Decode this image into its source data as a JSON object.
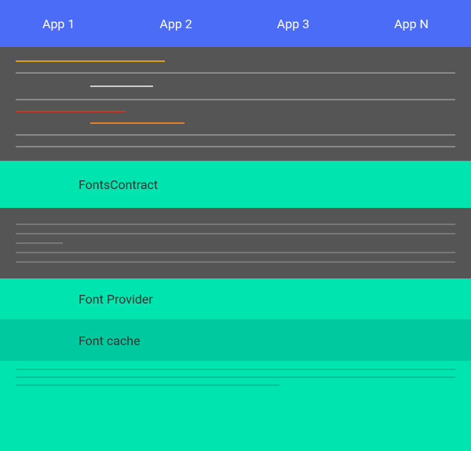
{
  "topBar": {
    "tabs": [
      {
        "id": "app1",
        "label": "App 1"
      },
      {
        "id": "app2",
        "label": "App 2"
      },
      {
        "id": "app3",
        "label": "App 3"
      },
      {
        "id": "appN",
        "label": "App N"
      }
    ]
  },
  "sections": {
    "fontsContract": "FontsContract",
    "fontProvider": "Font Provider",
    "fontCache": "Font cache"
  },
  "colors": {
    "topBar": "#4b6cf7",
    "darkSection": "#555555",
    "tealMain": "#00e5b0",
    "tealAlt": "#00c9a0"
  }
}
